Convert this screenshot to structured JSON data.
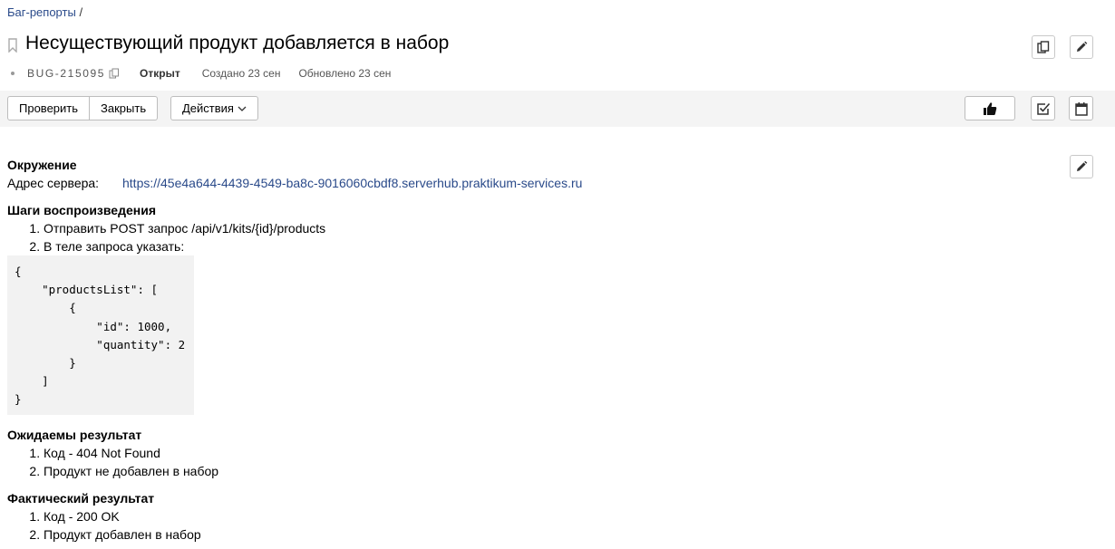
{
  "breadcrumb": {
    "link": "Баг-репорты",
    "sep": "/"
  },
  "title": "Несуществующий продукт добавляется в набор",
  "meta": {
    "key": "BUG-215095",
    "status": "Открыт",
    "created": "Создано 23 сен",
    "updated": "Обновлено 23 сен"
  },
  "toolbar": {
    "check_label": "Проверить",
    "close_label": "Закрыть",
    "actions_label": "Действия"
  },
  "description": {
    "env_heading": "Окружение",
    "server_label": "Адрес сервера:",
    "server_url": "https://45e4a644-4439-4549-ba8c-9016060cbdf8.serverhub.praktikum-services.ru",
    "steps_heading": "Шаги воспроизведения",
    "steps": [
      "Отправить POST запрос /api/v1/kits/{id}/products",
      "В теле запроса указать:"
    ],
    "code": "{\n    \"productsList\": [\n        {\n            \"id\": 1000,\n            \"quantity\": 2\n        }\n    ]\n}",
    "expected_heading": "Ожидаемы результат",
    "expected": [
      "Код - 404 Not Found",
      "Продукт не добавлен в набор"
    ],
    "actual_heading": "Фактический результат",
    "actual": [
      "Код - 200 OK",
      "Продукт добавлен в набор"
    ]
  },
  "icons": {
    "bookmark": "bookmark-icon",
    "copy": "copy-icon",
    "pencil": "pencil-icon",
    "like": "thumbs-up-icon",
    "checklist": "checkbox-icon",
    "calendar": "calendar-icon"
  }
}
